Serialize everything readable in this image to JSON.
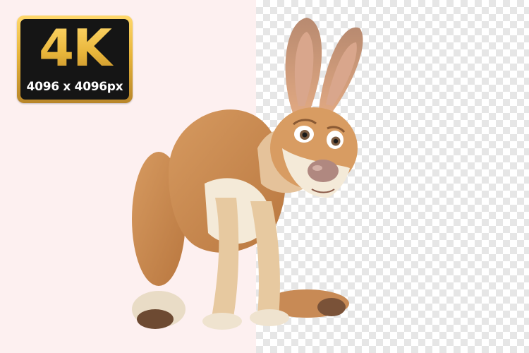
{
  "badge": {
    "title": "4K",
    "resolution": "4096 x 4096px",
    "gold": "#e8b53a",
    "gold_light": "#ffd86b",
    "dark": "#151515"
  },
  "background": {
    "left_color": "#fdf0f0",
    "checker_light": "#ffffff",
    "checker_dark": "#e6e6e6"
  },
  "subject": {
    "fur_main": "#c98a52",
    "fur_light": "#f4ead8",
    "fur_dark": "#8a5a34",
    "nose": "#b08880"
  }
}
